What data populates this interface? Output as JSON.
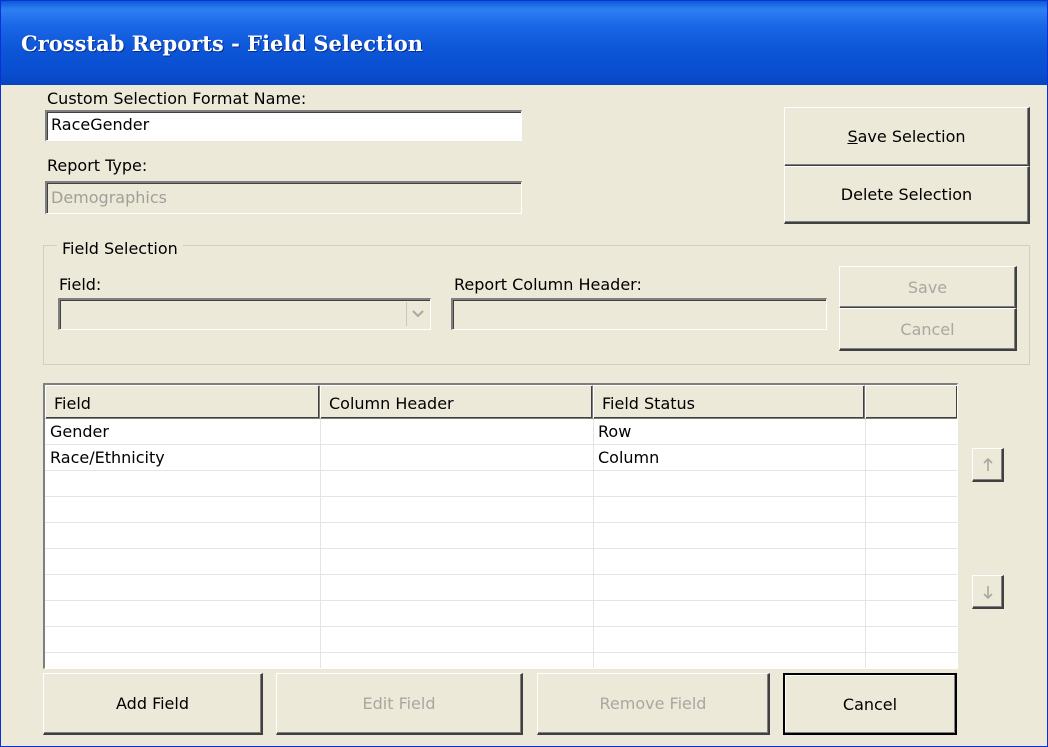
{
  "window": {
    "title": "Crosstab Reports - Field Selection"
  },
  "format": {
    "name_label": "Custom Selection Format Name:",
    "name_value": "RaceGender",
    "report_type_label": "Report Type:",
    "report_type_value": "Demographics"
  },
  "actions": {
    "save_selection": {
      "prefix": "",
      "mnemonic": "S",
      "rest": "ave Selection"
    },
    "delete_selection": "Delete Selection"
  },
  "field_selection": {
    "legend": "Field Selection",
    "field_label": "Field:",
    "field_value": "",
    "header_label": "Report Column Header:",
    "header_value": "",
    "save": "Save",
    "cancel": "Cancel"
  },
  "grid": {
    "columns": [
      "Field",
      "Column Header",
      "Field Status",
      ""
    ],
    "rows": [
      [
        "Gender",
        "",
        "Row",
        ""
      ],
      [
        "Race/Ethnicity",
        "",
        "Column",
        ""
      ],
      [
        "",
        "",
        "",
        ""
      ],
      [
        "",
        "",
        "",
        ""
      ],
      [
        "",
        "",
        "",
        ""
      ],
      [
        "",
        "",
        "",
        ""
      ],
      [
        "",
        "",
        "",
        ""
      ],
      [
        "",
        "",
        "",
        ""
      ],
      [
        "",
        "",
        "",
        ""
      ]
    ]
  },
  "move": {
    "up_icon": "arrow-up-icon",
    "down_icon": "arrow-down-icon"
  },
  "footer": {
    "add_field": "Add Field",
    "edit_field": "Edit Field",
    "remove_field": "Remove Field",
    "cancel": "Cancel"
  },
  "colors": {
    "titlebar": "#0a55d6",
    "dialog_bg": "#ece9d8",
    "disabled_text": "#a8a8a0"
  }
}
